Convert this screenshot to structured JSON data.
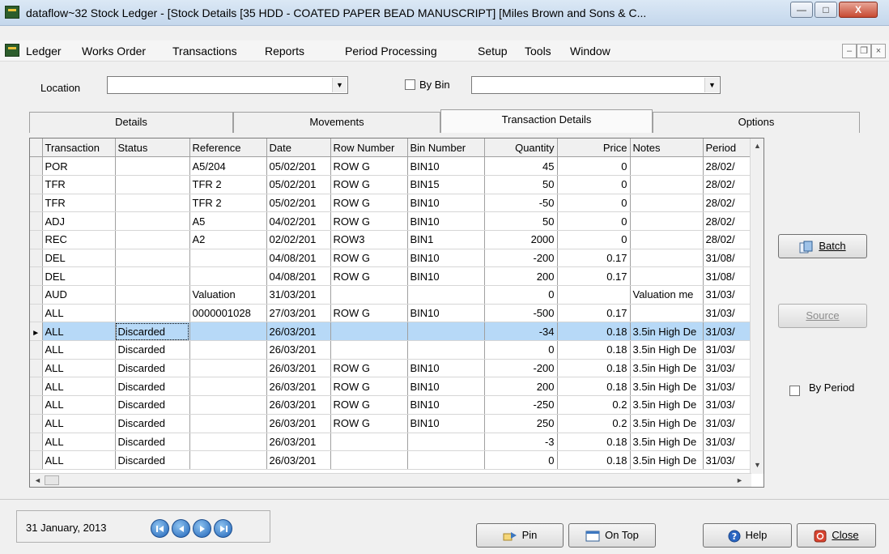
{
  "window": {
    "title": "dataflow~32 Stock Ledger - [Stock Details [35 HDD - COATED PAPER BEAD MANUSCRIPT] [Miles Brown and Sons & C...",
    "min_glyph": "—",
    "max_glyph": "□",
    "close_glyph": "X"
  },
  "menu": {
    "items": [
      "Ledger",
      "Works Order",
      "Transactions",
      "Reports",
      "Period Processing",
      "Setup",
      "Tools",
      "Window"
    ],
    "mdi_min": "–",
    "mdi_restore": "❐",
    "mdi_close": "×"
  },
  "filters": {
    "location_label": "Location",
    "location_value": "",
    "by_bin_label": "By Bin",
    "by_bin_checked": false,
    "bin_value": ""
  },
  "tabs": [
    {
      "label": "Details",
      "active": false
    },
    {
      "label": "Movements",
      "active": false
    },
    {
      "label": "Transaction Details",
      "active": true
    },
    {
      "label": "Options",
      "active": false
    }
  ],
  "grid": {
    "columns": [
      "Transaction",
      "Status",
      "Reference",
      "Date",
      "Row Number",
      "Bin Number",
      "Quantity",
      "Price",
      "Notes",
      "Period"
    ],
    "rows": [
      [
        "POR",
        "",
        "A5/204",
        "05/02/201",
        "ROW G",
        "BIN10",
        "45",
        "0",
        "",
        "28/02/"
      ],
      [
        "TFR",
        "",
        "TFR 2",
        "05/02/201",
        "ROW G",
        "BIN15",
        "50",
        "0",
        "",
        "28/02/"
      ],
      [
        "TFR",
        "",
        "TFR 2",
        "05/02/201",
        "ROW G",
        "BIN10",
        "-50",
        "0",
        "",
        "28/02/"
      ],
      [
        "ADJ",
        "",
        "A5",
        "04/02/201",
        "ROW G",
        "BIN10",
        "50",
        "0",
        "",
        "28/02/"
      ],
      [
        "REC",
        "",
        "A2",
        "02/02/201",
        "ROW3",
        "BIN1",
        "2000",
        "0",
        "",
        "28/02/"
      ],
      [
        "DEL",
        "",
        "",
        "04/08/201",
        "ROW G",
        "BIN10",
        "-200",
        "0.17",
        "",
        "31/08/"
      ],
      [
        "DEL",
        "",
        "",
        "04/08/201",
        "ROW G",
        "BIN10",
        "200",
        "0.17",
        "",
        "31/08/"
      ],
      [
        "AUD",
        "",
        "Valuation",
        "31/03/201",
        "",
        "",
        "0",
        "",
        "Valuation me",
        "31/03/"
      ],
      [
        "ALL",
        "",
        "0000001028",
        "27/03/201",
        "ROW G",
        "BIN10",
        "-500",
        "0.17",
        "",
        "31/03/"
      ],
      [
        "ALL",
        "Discarded",
        "",
        "26/03/201",
        "",
        "",
        "-34",
        "0.18",
        "3.5in High De",
        "31/03/"
      ],
      [
        "ALL",
        "Discarded",
        "",
        "26/03/201",
        "",
        "",
        "0",
        "0.18",
        "3.5in High De",
        "31/03/"
      ],
      [
        "ALL",
        "Discarded",
        "",
        "26/03/201",
        "ROW G",
        "BIN10",
        "-200",
        "0.18",
        "3.5in High De",
        "31/03/"
      ],
      [
        "ALL",
        "Discarded",
        "",
        "26/03/201",
        "ROW G",
        "BIN10",
        "200",
        "0.18",
        "3.5in High De",
        "31/03/"
      ],
      [
        "ALL",
        "Discarded",
        "",
        "26/03/201",
        "ROW G",
        "BIN10",
        "-250",
        "0.2",
        "3.5in High De",
        "31/03/"
      ],
      [
        "ALL",
        "Discarded",
        "",
        "26/03/201",
        "ROW G",
        "BIN10",
        "250",
        "0.2",
        "3.5in High De",
        "31/03/"
      ],
      [
        "ALL",
        "Discarded",
        "",
        "26/03/201",
        "",
        "",
        "-3",
        "0.18",
        "3.5in High De",
        "31/03/"
      ],
      [
        "ALL",
        "Discarded",
        "",
        "26/03/201",
        "",
        "",
        "0",
        "0.18",
        "3.5in High De",
        "31/03/"
      ]
    ],
    "selected_row": 9
  },
  "side": {
    "batch_label": "Batch",
    "source_label": "Source",
    "by_period_label": "By Period",
    "by_period_checked": false
  },
  "status": {
    "date": "31 January, 2013",
    "pin_label": "Pin",
    "on_top_label": "On Top",
    "help_label": "Help",
    "close_label": "Close"
  },
  "colors": {
    "selection": "#b7d9f7",
    "nav_button": "#1f63b8"
  }
}
